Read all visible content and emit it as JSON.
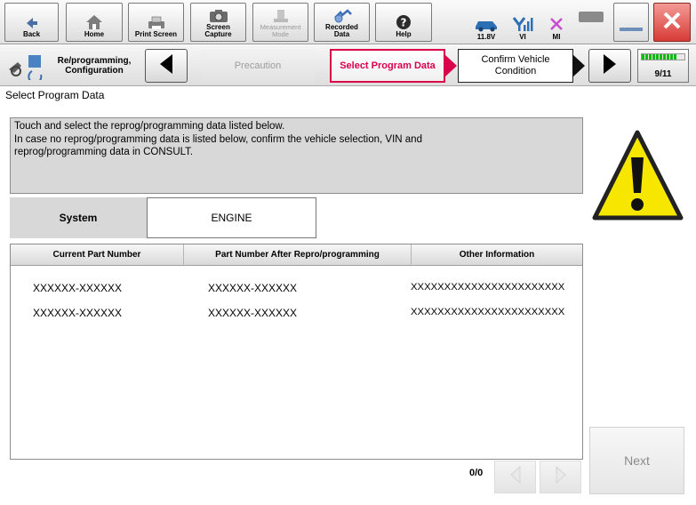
{
  "toolbar": {
    "buttons": [
      {
        "label": "Back"
      },
      {
        "label": "Home"
      },
      {
        "label": "Print Screen"
      },
      {
        "label": "Screen\nCapture"
      },
      {
        "label": "Measurement\nMode"
      },
      {
        "label": "Recorded\nData"
      },
      {
        "label": "Help"
      }
    ],
    "status": {
      "battery": "11.8V",
      "vi": "VI",
      "mi": "MI"
    }
  },
  "nav": {
    "section": "Re/programming,\nConfiguration",
    "steps": {
      "previous": "Precaution",
      "current": "Select Program Data",
      "next": "Confirm Vehicle\nCondition"
    },
    "progress": "9/11",
    "progress_fraction": 0.818
  },
  "page_title": "Select Program Data",
  "instructions": "Touch and select the reprog/programming data listed below.\nIn case no reprog/programming data is listed below, confirm the vehicle selection, VIN and\nreprog/programming data in CONSULT.",
  "system": {
    "label": "System",
    "value": "ENGINE"
  },
  "table": {
    "columns": [
      "Current Part Number",
      "Part Number After Repro/programming",
      "Other Information"
    ],
    "rows": [
      [
        "XXXXXX-XXXXXX",
        "XXXXXX-XXXXXX",
        "XXXXXXXXXXXXXXXXXXXXXXX"
      ],
      [
        "XXXXXX-XXXXXX",
        "XXXXXX-XXXXXX",
        "XXXXXXXXXXXXXXXXXXXXXXX"
      ]
    ]
  },
  "pager": {
    "count": "0/0"
  },
  "next_button": "Next",
  "colors": {
    "accent": "#d9004c",
    "warning": "#f7e600",
    "close": "#e0423e"
  }
}
